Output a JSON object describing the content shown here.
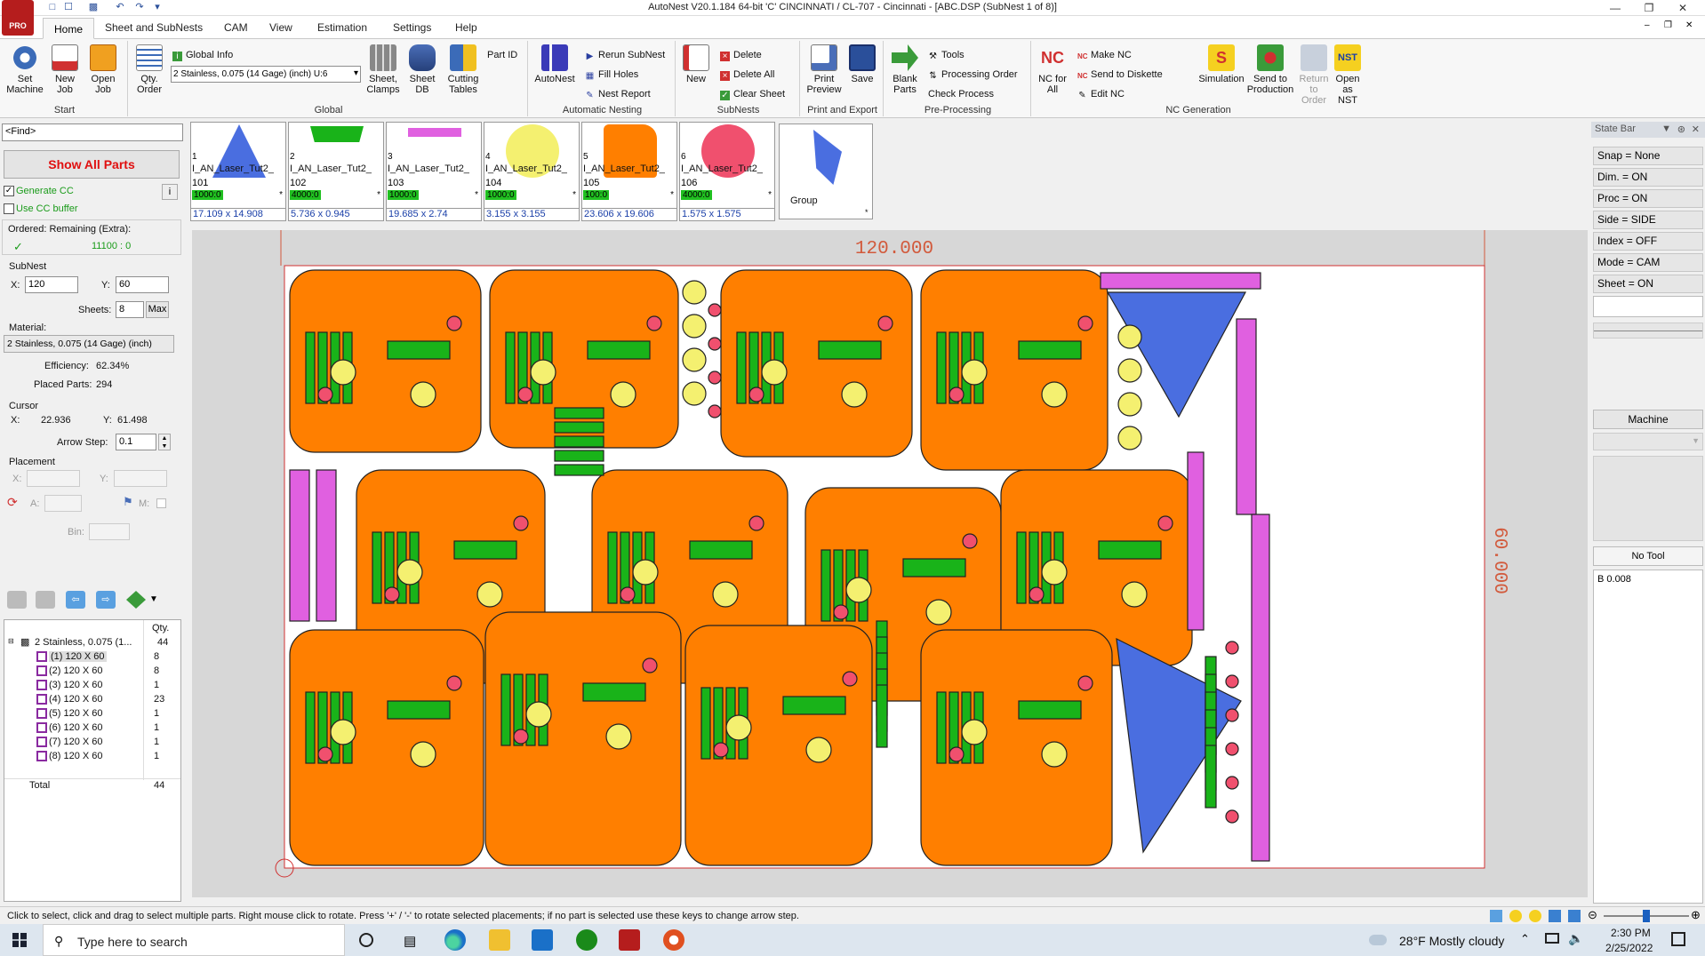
{
  "window": {
    "title": "AutoNest V20.1.184 64-bit     'C' CINCINNATI / CL-707     - Cincinnati - [ABC.DSP (SubNest 1 of 8)]"
  },
  "menu_tabs": [
    "Home",
    "Sheet and SubNests",
    "CAM",
    "View",
    "Estimation",
    "Settings",
    "Help"
  ],
  "ribbon": {
    "start": {
      "set_machine": "Set Machine",
      "new_job": "New Job",
      "open_job": "Open Job",
      "label": "Start"
    },
    "global": {
      "qty_order": "Qty. Order",
      "global_info": "Global Info",
      "material_select": "2  Stainless, 0.075 (14 Gage) (inch)  U:6",
      "sheet_clamps": "Sheet, Clamps",
      "sheet_db": "Sheet DB",
      "cutting_tables": "Cutting Tables",
      "part_id": "Part ID",
      "label": "Global"
    },
    "automatic_nesting": {
      "autonest": "AutoNest",
      "rerun_subnest": "Rerun SubNest",
      "fill_holes": "Fill Holes",
      "nest_report": "Nest Report",
      "label": "Automatic Nesting"
    },
    "subnests": {
      "new": "New",
      "delete": "Delete",
      "delete_all": "Delete All",
      "clear_sheet": "Clear Sheet",
      "label": "SubNests"
    },
    "print_export": {
      "print_preview": "Print Preview",
      "save": "Save",
      "label": "Print and Export"
    },
    "preprocessing": {
      "blank_parts": "Blank Parts",
      "tools": "Tools",
      "processing_order": "Processing Order",
      "check_process": "Check Process",
      "label": "Pre-Processing"
    },
    "nc_generation": {
      "nc_for_all": "NC for All",
      "make_nc": "Make NC",
      "send_to_diskette": "Send to Diskette",
      "edit_nc": "Edit NC",
      "simulation": "Simulation",
      "send_to_production": "Send to Production",
      "return_to_order": "Return to Order",
      "open_as_nst": "Open as NST",
      "label": "NC Generation"
    }
  },
  "left_panel": {
    "find_placeholder": "<Find>",
    "show_all_parts": "Show All Parts",
    "generate_cc": "Generate CC",
    "use_cc_buffer": "Use CC buffer",
    "ordered_label": "Ordered: Remaining (Extra):",
    "ordered_value": "11100 : 0",
    "subnest_label": "SubNest",
    "x_label": "X:",
    "x_value": "120",
    "y_label": "Y:",
    "y_value": "60",
    "sheets_label": "Sheets:",
    "sheets_value": "8",
    "max_label": "Max",
    "material_label": "Material:",
    "material_value": "2  Stainless, 0.075 (14 Gage) (inch)",
    "efficiency_label": "Efficiency:",
    "efficiency_value": "62.34%",
    "placed_label": "Placed Parts:",
    "placed_value": "294",
    "cursor_label": "Cursor",
    "cursor_x_label": "X:",
    "cursor_x": "22.936",
    "cursor_y_label": "Y:",
    "cursor_y": "61.498",
    "arrow_step_label": "Arrow Step:",
    "arrow_step": "0.1",
    "placement_label": "Placement",
    "a_label": "A:",
    "m_label": "M:",
    "bin_label": "Bin:",
    "tree_qty_header": "Qty.",
    "tree_root": "2  Stainless, 0.075 (1...",
    "tree_root_qty": "44",
    "tree_items": [
      {
        "label": "(1) 120 X 60",
        "qty": "8"
      },
      {
        "label": "(2) 120 X 60",
        "qty": "8"
      },
      {
        "label": "(3) 120 X 60",
        "qty": "1"
      },
      {
        "label": "(4) 120 X 60",
        "qty": "23"
      },
      {
        "label": "(5) 120 X 60",
        "qty": "1"
      },
      {
        "label": "(6) 120 X 60",
        "qty": "1"
      },
      {
        "label": "(7) 120 X 60",
        "qty": "1"
      },
      {
        "label": "(8) 120 X 60",
        "qty": "1"
      }
    ],
    "tree_total_label": "Total",
    "tree_total": "44"
  },
  "parts_strip": [
    {
      "num": "1",
      "name": "I_AN_Laser_Tut2_",
      "id": "101",
      "qty": "1000:0",
      "dims": "17.109 x 14.908",
      "color": "#4a6ee0"
    },
    {
      "num": "2",
      "name": "I_AN_Laser_Tut2_",
      "id": "102",
      "qty": "4000:0",
      "dims": "5.736 x 0.945",
      "color": "#19b319"
    },
    {
      "num": "3",
      "name": "I_AN_Laser_Tut2_",
      "id": "103",
      "qty": "1000:0",
      "dims": "19.685 x 2.74",
      "color": "#e060e0"
    },
    {
      "num": "4",
      "name": "I_AN_Laser_Tut2_",
      "id": "104",
      "qty": "1000:0",
      "dims": "3.155 x 3.155",
      "color": "#f4f070"
    },
    {
      "num": "5",
      "name": "I_AN_Laser_Tut2_",
      "id": "105",
      "qty": "100:0",
      "dims": "23.606 x 19.606",
      "color": "#ff7f00"
    },
    {
      "num": "6",
      "name": "I_AN_Laser_Tut2_",
      "id": "106",
      "qty": "4000:0",
      "dims": "1.575 x 1.575",
      "color": "#f0506e"
    }
  ],
  "group_label": "Group",
  "sheet": {
    "width_label": "120.000",
    "height_label": "60.000"
  },
  "state_bar": {
    "title": "State Bar",
    "items": [
      "Snap = None",
      "Dim. = ON",
      "Proc = ON",
      "Side = SIDE",
      "Index = OFF",
      "Mode = CAM",
      "Sheet = ON"
    ],
    "machine": "Machine",
    "no_tool": "No Tool",
    "b_value": "B 0.008"
  },
  "status_text": "Click to select, click and drag to select multiple parts. Right mouse click to rotate. Press '+' / '-' to rotate selected placements; if no part is selected use these keys to change arrow step.",
  "taskbar": {
    "search_placeholder": "Type here to search",
    "weather": "28°F  Mostly cloudy",
    "time": "2:30 PM",
    "date": "2/25/2022"
  }
}
